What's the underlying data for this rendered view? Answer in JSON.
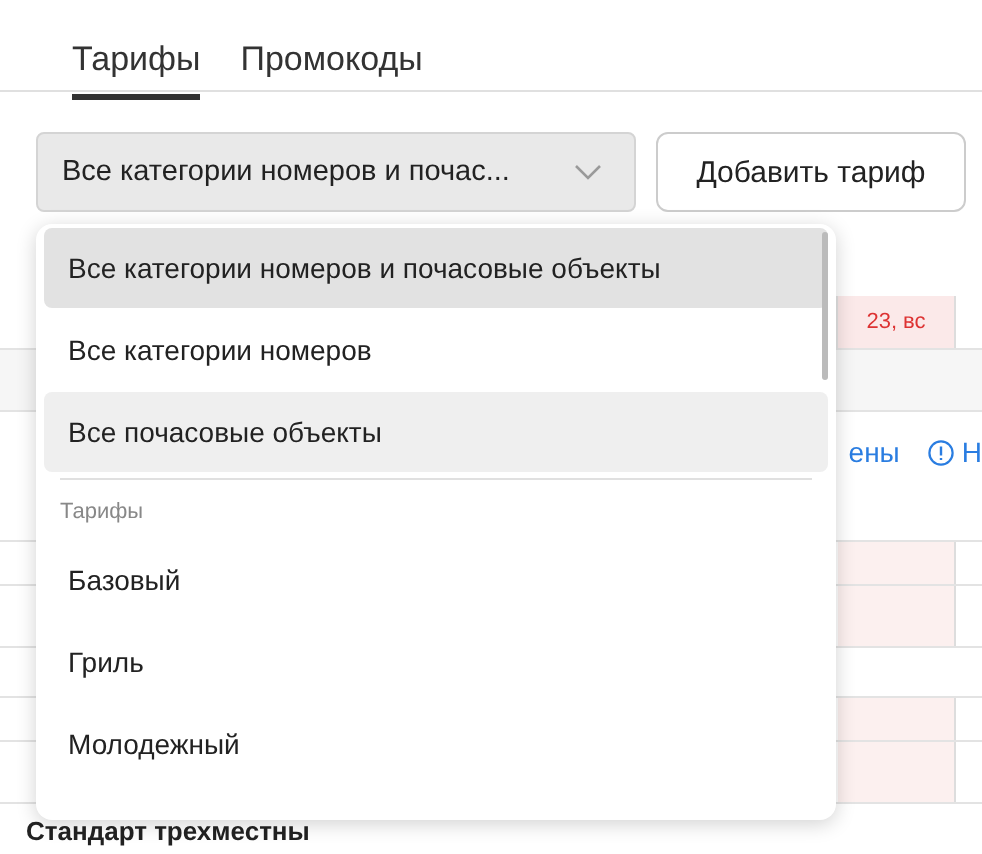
{
  "tabs": [
    {
      "label": "Тарифы",
      "selected": true
    },
    {
      "label": "Промокоды",
      "selected": false
    }
  ],
  "filter": {
    "value": "Все категории номеров и почас..."
  },
  "add_button": "Добавить тариф",
  "dropdown": {
    "items": [
      {
        "label": "Все категории номеров и почасовые объекты",
        "selected": true,
        "hovered": false
      },
      {
        "label": "Все категории номеров",
        "selected": false,
        "hovered": false
      },
      {
        "label": "Все почасовые объекты",
        "selected": false,
        "hovered": true
      }
    ],
    "group": {
      "label": "Тарифы",
      "items": [
        {
          "label": "Базовый",
          "selected": false
        },
        {
          "label": "Гриль",
          "selected": false
        },
        {
          "label": "Молодежный",
          "selected": false
        }
      ]
    }
  },
  "calendar": {
    "day": "23, вс",
    "legend": [
      {
        "kind": "link",
        "label": "ены"
      },
      {
        "kind": "info",
        "label": "Н"
      }
    ],
    "sections": [
      {
        "title": "Стандарт трехместны"
      }
    ]
  }
}
